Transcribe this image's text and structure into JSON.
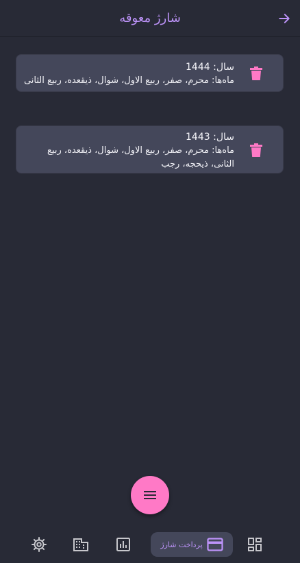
{
  "header": {
    "title": "شارژ معوقه"
  },
  "items": [
    {
      "year_line": "سال: 1444",
      "months_line": "ماه‌ها: محرم، صفر، ربیع الاول، شوال، ذیقعده، ربیع الثانی"
    },
    {
      "year_line": "سال: 1443",
      "months_line": "ماه‌ها: محرم، صفر، ربیع الاول، شوال، ذیقعده، ربیع الثانی، ذیحجه، رجب"
    }
  ],
  "nav": {
    "active_label": "پرداخت شارژ",
    "items": [
      "settings-icon",
      "apartment-icon",
      "chart-icon",
      "payment-card-icon",
      "dashboard-icon"
    ]
  },
  "colors": {
    "background": "#282a36",
    "card": "#44475a",
    "accent_purple": "#bd93f9",
    "accent_pink": "#ff79c6",
    "icon_gray": "#c7c7cc"
  }
}
